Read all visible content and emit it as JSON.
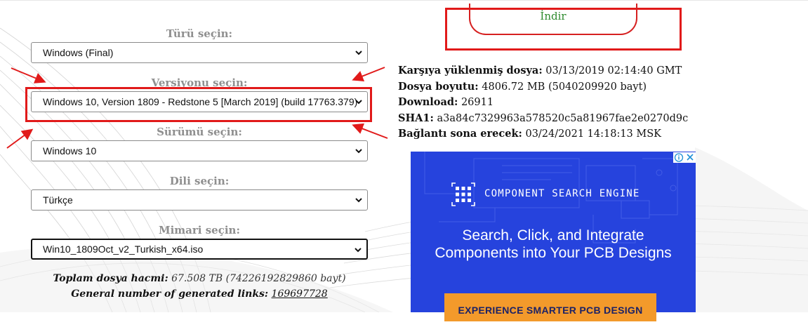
{
  "form": {
    "type_label": "Türü seçin:",
    "type_value": "Windows (Final)",
    "version_label": "Versiyonu seçin:",
    "version_value": "Windows 10, Version 1809 - Redstone 5 [March 2019] (build 17763.379)",
    "edition_label": "Sürümü seçin:",
    "edition_value": "Windows 10",
    "language_label": "Dili seçin:",
    "language_value": "Türkçe",
    "arch_label": "Mimari seçin:",
    "arch_value": "Win10_1809Oct_v2_Turkish_x64.iso"
  },
  "summary": {
    "total_label": "Toplam dosya hacmi:",
    "total_value": "67.508 TB (74226192829860 bayt)",
    "links_label": "General number of generated links:",
    "links_value": "169697728"
  },
  "download": {
    "label": "İndir"
  },
  "file_info": {
    "uploaded_label": "Karşıya yüklenmiş dosya:",
    "uploaded_value": "03/13/2019 02:14:40 GMT",
    "size_label": "Dosya boyutu:",
    "size_value": "4806.72 MB (5040209920 bayt)",
    "download_label": "Download:",
    "download_value": "26911",
    "sha1_label": "SHA1:",
    "sha1_value": "a3a84c7329963a578520c5a81967fae2e0270d9c",
    "expires_label": "Bağlantı sona erecek:",
    "expires_value": "03/24/2021 14:18:13 MSK"
  },
  "ad": {
    "brand": "COMPONENT SEARCH ENGINE",
    "headline_line1": "Search, Click, and Integrate",
    "headline_line2": "Components into Your PCB Designs",
    "cta": "EXPERIENCE SMARTER PCB DESIGN",
    "bg_color": "#2643dd",
    "cta_color": "#f39a2b"
  },
  "annotation_color": "#e11a1a",
  "icons": [
    "chevron-down-icon",
    "adchoices-icon",
    "close-icon",
    "grid-logo-icon",
    "red-arrow-icon"
  ]
}
